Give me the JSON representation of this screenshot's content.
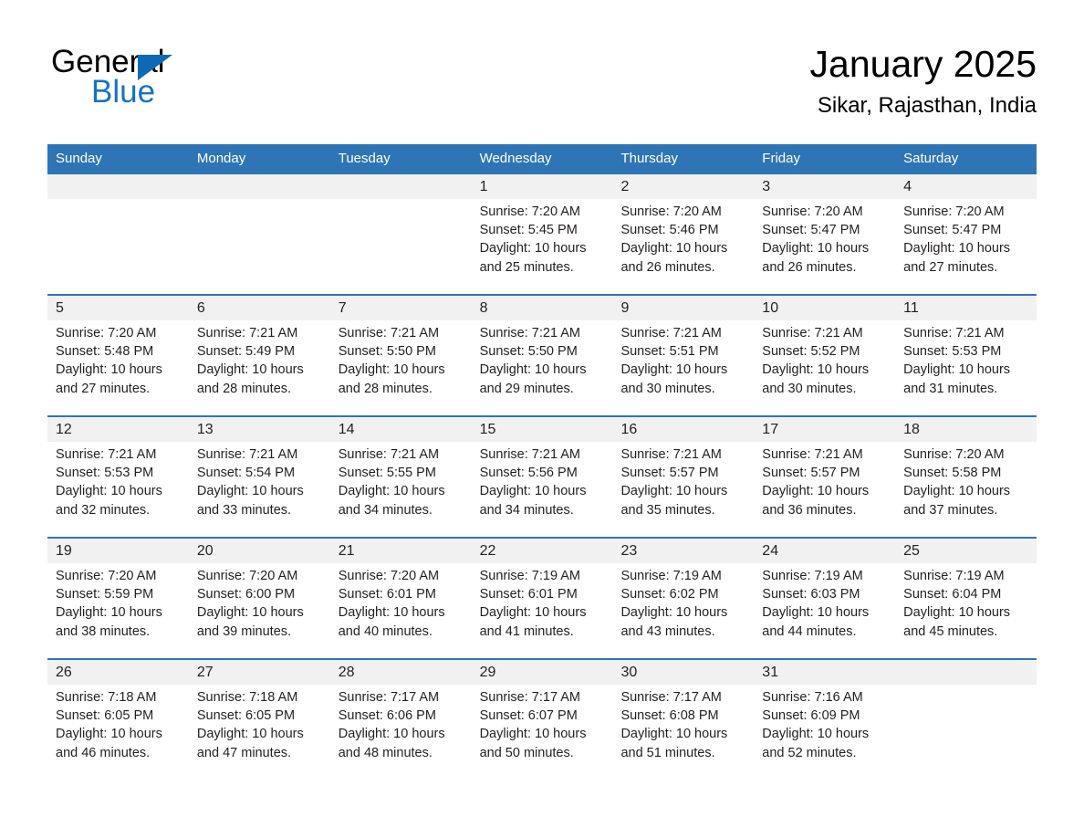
{
  "logo": {
    "word1": "General",
    "word2": "Blue",
    "triangle_color": "#0a6ab5",
    "word2_color": "#1673c4"
  },
  "header": {
    "month_title": "January 2025",
    "location": "Sikar, Rajasthan, India"
  },
  "theme": {
    "header_blue": "#2e75b6",
    "daynum_band": "#f1f1f1",
    "text": "#231f20"
  },
  "weekdays": [
    "Sunday",
    "Monday",
    "Tuesday",
    "Wednesday",
    "Thursday",
    "Friday",
    "Saturday"
  ],
  "weeks": [
    [
      {
        "day": "",
        "sunrise": "",
        "sunset": "",
        "daylight1": "",
        "daylight2": ""
      },
      {
        "day": "",
        "sunrise": "",
        "sunset": "",
        "daylight1": "",
        "daylight2": ""
      },
      {
        "day": "",
        "sunrise": "",
        "sunset": "",
        "daylight1": "",
        "daylight2": ""
      },
      {
        "day": "1",
        "sunrise": "Sunrise: 7:20 AM",
        "sunset": "Sunset: 5:45 PM",
        "daylight1": "Daylight: 10 hours",
        "daylight2": "and 25 minutes."
      },
      {
        "day": "2",
        "sunrise": "Sunrise: 7:20 AM",
        "sunset": "Sunset: 5:46 PM",
        "daylight1": "Daylight: 10 hours",
        "daylight2": "and 26 minutes."
      },
      {
        "day": "3",
        "sunrise": "Sunrise: 7:20 AM",
        "sunset": "Sunset: 5:47 PM",
        "daylight1": "Daylight: 10 hours",
        "daylight2": "and 26 minutes."
      },
      {
        "day": "4",
        "sunrise": "Sunrise: 7:20 AM",
        "sunset": "Sunset: 5:47 PM",
        "daylight1": "Daylight: 10 hours",
        "daylight2": "and 27 minutes."
      }
    ],
    [
      {
        "day": "5",
        "sunrise": "Sunrise: 7:20 AM",
        "sunset": "Sunset: 5:48 PM",
        "daylight1": "Daylight: 10 hours",
        "daylight2": "and 27 minutes."
      },
      {
        "day": "6",
        "sunrise": "Sunrise: 7:21 AM",
        "sunset": "Sunset: 5:49 PM",
        "daylight1": "Daylight: 10 hours",
        "daylight2": "and 28 minutes."
      },
      {
        "day": "7",
        "sunrise": "Sunrise: 7:21 AM",
        "sunset": "Sunset: 5:50 PM",
        "daylight1": "Daylight: 10 hours",
        "daylight2": "and 28 minutes."
      },
      {
        "day": "8",
        "sunrise": "Sunrise: 7:21 AM",
        "sunset": "Sunset: 5:50 PM",
        "daylight1": "Daylight: 10 hours",
        "daylight2": "and 29 minutes."
      },
      {
        "day": "9",
        "sunrise": "Sunrise: 7:21 AM",
        "sunset": "Sunset: 5:51 PM",
        "daylight1": "Daylight: 10 hours",
        "daylight2": "and 30 minutes."
      },
      {
        "day": "10",
        "sunrise": "Sunrise: 7:21 AM",
        "sunset": "Sunset: 5:52 PM",
        "daylight1": "Daylight: 10 hours",
        "daylight2": "and 30 minutes."
      },
      {
        "day": "11",
        "sunrise": "Sunrise: 7:21 AM",
        "sunset": "Sunset: 5:53 PM",
        "daylight1": "Daylight: 10 hours",
        "daylight2": "and 31 minutes."
      }
    ],
    [
      {
        "day": "12",
        "sunrise": "Sunrise: 7:21 AM",
        "sunset": "Sunset: 5:53 PM",
        "daylight1": "Daylight: 10 hours",
        "daylight2": "and 32 minutes."
      },
      {
        "day": "13",
        "sunrise": "Sunrise: 7:21 AM",
        "sunset": "Sunset: 5:54 PM",
        "daylight1": "Daylight: 10 hours",
        "daylight2": "and 33 minutes."
      },
      {
        "day": "14",
        "sunrise": "Sunrise: 7:21 AM",
        "sunset": "Sunset: 5:55 PM",
        "daylight1": "Daylight: 10 hours",
        "daylight2": "and 34 minutes."
      },
      {
        "day": "15",
        "sunrise": "Sunrise: 7:21 AM",
        "sunset": "Sunset: 5:56 PM",
        "daylight1": "Daylight: 10 hours",
        "daylight2": "and 34 minutes."
      },
      {
        "day": "16",
        "sunrise": "Sunrise: 7:21 AM",
        "sunset": "Sunset: 5:57 PM",
        "daylight1": "Daylight: 10 hours",
        "daylight2": "and 35 minutes."
      },
      {
        "day": "17",
        "sunrise": "Sunrise: 7:21 AM",
        "sunset": "Sunset: 5:57 PM",
        "daylight1": "Daylight: 10 hours",
        "daylight2": "and 36 minutes."
      },
      {
        "day": "18",
        "sunrise": "Sunrise: 7:20 AM",
        "sunset": "Sunset: 5:58 PM",
        "daylight1": "Daylight: 10 hours",
        "daylight2": "and 37 minutes."
      }
    ],
    [
      {
        "day": "19",
        "sunrise": "Sunrise: 7:20 AM",
        "sunset": "Sunset: 5:59 PM",
        "daylight1": "Daylight: 10 hours",
        "daylight2": "and 38 minutes."
      },
      {
        "day": "20",
        "sunrise": "Sunrise: 7:20 AM",
        "sunset": "Sunset: 6:00 PM",
        "daylight1": "Daylight: 10 hours",
        "daylight2": "and 39 minutes."
      },
      {
        "day": "21",
        "sunrise": "Sunrise: 7:20 AM",
        "sunset": "Sunset: 6:01 PM",
        "daylight1": "Daylight: 10 hours",
        "daylight2": "and 40 minutes."
      },
      {
        "day": "22",
        "sunrise": "Sunrise: 7:19 AM",
        "sunset": "Sunset: 6:01 PM",
        "daylight1": "Daylight: 10 hours",
        "daylight2": "and 41 minutes."
      },
      {
        "day": "23",
        "sunrise": "Sunrise: 7:19 AM",
        "sunset": "Sunset: 6:02 PM",
        "daylight1": "Daylight: 10 hours",
        "daylight2": "and 43 minutes."
      },
      {
        "day": "24",
        "sunrise": "Sunrise: 7:19 AM",
        "sunset": "Sunset: 6:03 PM",
        "daylight1": "Daylight: 10 hours",
        "daylight2": "and 44 minutes."
      },
      {
        "day": "25",
        "sunrise": "Sunrise: 7:19 AM",
        "sunset": "Sunset: 6:04 PM",
        "daylight1": "Daylight: 10 hours",
        "daylight2": "and 45 minutes."
      }
    ],
    [
      {
        "day": "26",
        "sunrise": "Sunrise: 7:18 AM",
        "sunset": "Sunset: 6:05 PM",
        "daylight1": "Daylight: 10 hours",
        "daylight2": "and 46 minutes."
      },
      {
        "day": "27",
        "sunrise": "Sunrise: 7:18 AM",
        "sunset": "Sunset: 6:05 PM",
        "daylight1": "Daylight: 10 hours",
        "daylight2": "and 47 minutes."
      },
      {
        "day": "28",
        "sunrise": "Sunrise: 7:17 AM",
        "sunset": "Sunset: 6:06 PM",
        "daylight1": "Daylight: 10 hours",
        "daylight2": "and 48 minutes."
      },
      {
        "day": "29",
        "sunrise": "Sunrise: 7:17 AM",
        "sunset": "Sunset: 6:07 PM",
        "daylight1": "Daylight: 10 hours",
        "daylight2": "and 50 minutes."
      },
      {
        "day": "30",
        "sunrise": "Sunrise: 7:17 AM",
        "sunset": "Sunset: 6:08 PM",
        "daylight1": "Daylight: 10 hours",
        "daylight2": "and 51 minutes."
      },
      {
        "day": "31",
        "sunrise": "Sunrise: 7:16 AM",
        "sunset": "Sunset: 6:09 PM",
        "daylight1": "Daylight: 10 hours",
        "daylight2": "and 52 minutes."
      },
      {
        "day": "",
        "sunrise": "",
        "sunset": "",
        "daylight1": "",
        "daylight2": ""
      }
    ]
  ]
}
